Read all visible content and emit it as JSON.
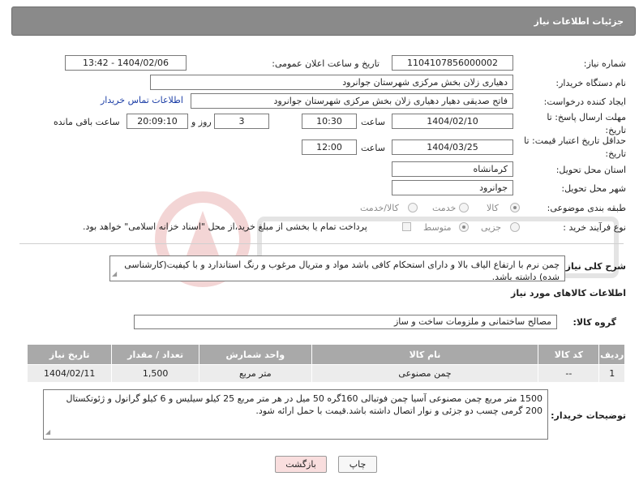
{
  "header": {
    "title": "جزئیات اطلاعات نیاز"
  },
  "need_number": {
    "label": "شماره نیاز:",
    "value": "1104107856000002"
  },
  "announce_datetime": {
    "label": "تاریخ و ساعت اعلان عمومی:",
    "value": "1404/02/06 - 13:42"
  },
  "buyer_org": {
    "label": "نام دستگاه خریدار:",
    "value": "دهیاری زلان بخش مرکزی شهرستان جوانرود"
  },
  "requester": {
    "label": "ایجاد کننده درخواست:",
    "value": "فاتح صدیقی دهیار دهیاری زلان بخش مرکزی شهرستان جوانرود",
    "contact_link": "اطلاعات تماس خریدار"
  },
  "reply_deadline": {
    "label": "مهلت ارسال پاسخ: تا تاریخ:",
    "date": "1404/02/10",
    "time_label": "ساعت",
    "time": "10:30",
    "days": "3",
    "days_label": "روز و",
    "remaining": "20:09:10",
    "remaining_label": "ساعت باقی مانده"
  },
  "price_validity": {
    "label": "حداقل تاریخ اعتبار قیمت: تا تاریخ:",
    "date": "1404/03/25",
    "time_label": "ساعت",
    "time": "12:00"
  },
  "province": {
    "label": "استان محل تحویل:",
    "value": "کرمانشاه"
  },
  "city": {
    "label": "شهر محل تحویل:",
    "value": "جوانرود"
  },
  "category": {
    "label": "طبقه بندی موضوعی:",
    "options": [
      "کالا",
      "خدمت",
      "کالا/خدمت"
    ],
    "selected": "کالا"
  },
  "purchase_type": {
    "label": "نوع فرآیند خرید :",
    "options": [
      "جزیی",
      "متوسط"
    ],
    "selected": "متوسط",
    "note": "پرداخت تمام یا بخشی از مبلغ خرید،از محل \"اسناد خزانه اسلامی\" خواهد بود."
  },
  "description": {
    "label": "شرح کلی نیاز:",
    "value": "چمن نرم با ارتفاع الیاف بالا و دارای استحکام کافی باشد مواد و متریال مرغوب و رنگ استاندارد و با کیفیت(کارشناسی شده) داشته باشد."
  },
  "goods_section": {
    "title": "اطلاعات کالاهای مورد نیاز"
  },
  "goods_group": {
    "label": "گروه کالا:",
    "value": "مصالح ساختمانی و ملزومات ساخت و ساز"
  },
  "items_table": {
    "headers": [
      "ردیف",
      "کد کالا",
      "نام کالا",
      "واحد شمارش",
      "تعداد / مقدار",
      "تاریخ نیاز"
    ],
    "rows": [
      [
        "1",
        "--",
        "چمن مصنوعی",
        "متر مربع",
        "1,500",
        "1404/02/11"
      ]
    ]
  },
  "buyer_notes": {
    "label": "توضیحات خریدار:",
    "value": "1500 متر مربع چمن مصنوعی آسیا چمن فوتبالی 160گره 50 میل در هر متر مربع 25 کیلو سیلیس و 6 کیلو گرانول و ژئوتکستال 200 گرمی چسب دو جزئی و نوار اتصال داشته باشد.قیمت با حمل ارائه شود."
  },
  "buttons": {
    "print": "چاپ",
    "back": "بازگشت"
  },
  "colors": {
    "header_bg": "#8a8a8a",
    "table_header_bg": "#a9a9a9",
    "link": "#1c3ea6",
    "back_button_bg": "#f9dede"
  }
}
